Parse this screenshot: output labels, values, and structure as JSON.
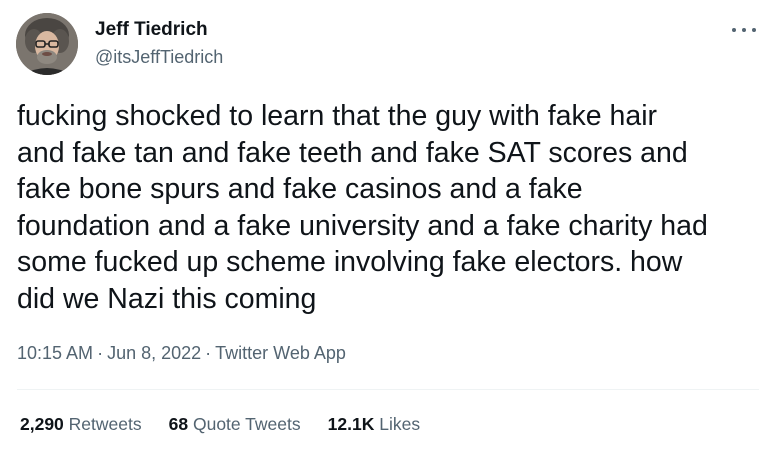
{
  "author": {
    "name": "Jeff Tiedrich",
    "handle": "@itsJeffTiedrich",
    "avatar_icon": "profile-photo"
  },
  "tweet": {
    "text": "fucking shocked to learn that the guy with fake hair\nand fake tan and fake teeth and fake SAT scores and\nfake bone spurs and fake casinos and a fake\nfoundation and a fake university and a fake charity had\nsome fucked up scheme involving fake electors. how\ndid we Nazi this coming",
    "time": "10:15 AM",
    "date": "Jun 8, 2022",
    "source": "Twitter Web App",
    "separator": "·"
  },
  "stats": {
    "retweets": {
      "count": "2,290",
      "label": "Retweets"
    },
    "quote_tweets": {
      "count": "68",
      "label": "Quote Tweets"
    },
    "likes": {
      "count": "12.1K",
      "label": "Likes"
    }
  },
  "colors": {
    "text": "#0f1419",
    "secondary": "#536471",
    "divider": "#eff3f4",
    "background": "#ffffff"
  },
  "icons": {
    "more": "more-options-icon"
  }
}
